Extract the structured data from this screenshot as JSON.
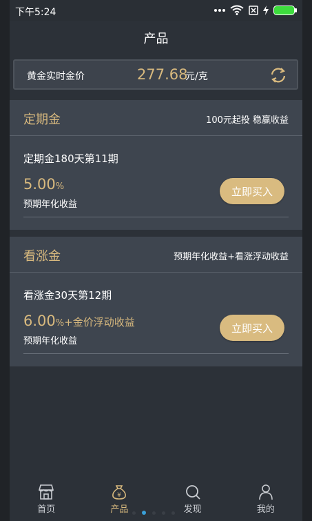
{
  "status": {
    "time": "下午5:24"
  },
  "header": {
    "title": "产品"
  },
  "gold_price": {
    "label": "黄金实时金价",
    "value": "277.68",
    "unit": "元/克"
  },
  "sections": [
    {
      "title": "定期金",
      "subtitle": "100元起投 稳赢收益",
      "product_name": "定期金180天第11期",
      "rate": "5.00",
      "rate_unit": "%",
      "rate_extra": "",
      "rate_label": "预期年化收益",
      "button": "立即买入"
    },
    {
      "title": "看涨金",
      "subtitle": "预期年化收益+看涨浮动收益",
      "product_name": "看涨金30天第12期",
      "rate": "6.00",
      "rate_unit": "%",
      "rate_extra": "+金价浮动收益",
      "rate_label": "预期年化收益",
      "button": "立即买入"
    }
  ],
  "tabs": [
    {
      "label": "首页",
      "icon": "home-icon"
    },
    {
      "label": "产品",
      "icon": "money-bag-icon"
    },
    {
      "label": "发现",
      "icon": "search-icon"
    },
    {
      "label": "我的",
      "icon": "user-icon"
    }
  ],
  "active_tab": 1,
  "colors": {
    "accent": "#d8b97e",
    "background": "#2c3138",
    "card": "#3e454f"
  }
}
